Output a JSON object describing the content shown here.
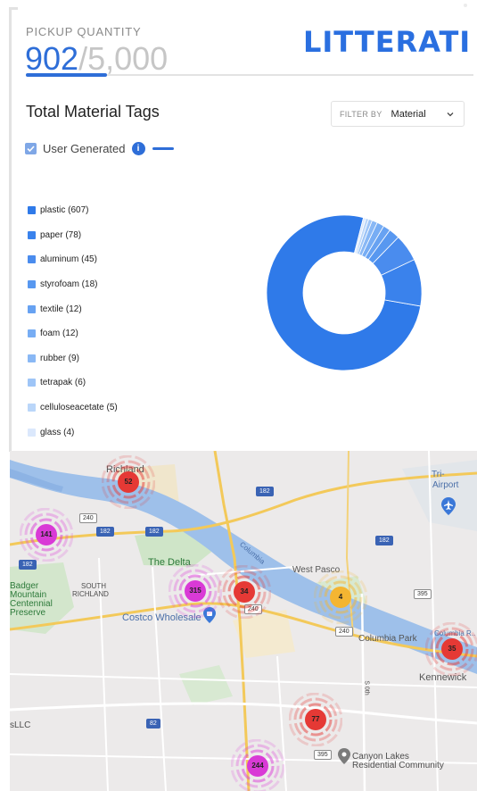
{
  "header": {
    "pickup_label": "PICKUP QUANTITY",
    "pickup_current": "902",
    "pickup_separator": "/",
    "pickup_goal": "5,000",
    "progress_fraction": 0.1804,
    "logo_text": "LITTERATI"
  },
  "section": {
    "title": "Total Material Tags",
    "filter_label": "FILTER BY",
    "filter_value": "Material"
  },
  "user_generated": {
    "label": "User Generated",
    "info_glyph": "i",
    "checked": true
  },
  "chart_data": {
    "type": "pie",
    "style": "donut",
    "categories": [
      "plastic",
      "paper",
      "aluminum",
      "styrofoam",
      "textile",
      "foam",
      "rubber",
      "tetrapak",
      "celluloseacetate",
      "glass"
    ],
    "values": [
      607,
      78,
      45,
      18,
      12,
      12,
      9,
      6,
      5,
      4
    ],
    "legend_labels": [
      "plastic (607)",
      "paper (78)",
      "aluminum (45)",
      "styrofoam (18)",
      "textile (12)",
      "foam (12)",
      "rubber (9)",
      "tetrapak (6)",
      "celluloseacetate (5)",
      "glass (4)"
    ],
    "colors": [
      "#2f7ae9",
      "#3a82ec",
      "#4a8cee",
      "#5898f0",
      "#67a2f2",
      "#77adf4",
      "#89b8f5",
      "#9ec5f7",
      "#bad6f9",
      "#dbe8fc"
    ],
    "legend_placement": "left"
  },
  "map": {
    "places": [
      "Richland",
      "Tri-",
      "Airport",
      "The Delta",
      "West Pasco",
      "Badger",
      "Mountain",
      "Centennial",
      "Preserve",
      "SOUTH",
      "RICHLAND",
      "Costco Wholesale",
      "Columbia Park",
      "Kennewick",
      "sLLC",
      "Canyon Lakes",
      "Residential Community",
      "Columbia R..",
      "Columbia"
    ],
    "shields": [
      "182",
      "240",
      "182",
      "182",
      "182",
      "182",
      "395",
      "240",
      "240",
      "82",
      "395",
      "S 0th"
    ],
    "clusters": [
      {
        "count": "52",
        "color": "#e53935"
      },
      {
        "count": "141",
        "color": "#d93ad6"
      },
      {
        "count": "315",
        "color": "#d93ad6"
      },
      {
        "count": "34",
        "color": "#e53935"
      },
      {
        "count": "4",
        "color": "#f4b532"
      },
      {
        "count": "35",
        "color": "#e53935"
      },
      {
        "count": "77",
        "color": "#e53935"
      },
      {
        "count": "244",
        "color": "#d93ad6"
      }
    ]
  },
  "colors": {
    "accent": "#2e6ed8",
    "logo": "#2a6fe0"
  }
}
